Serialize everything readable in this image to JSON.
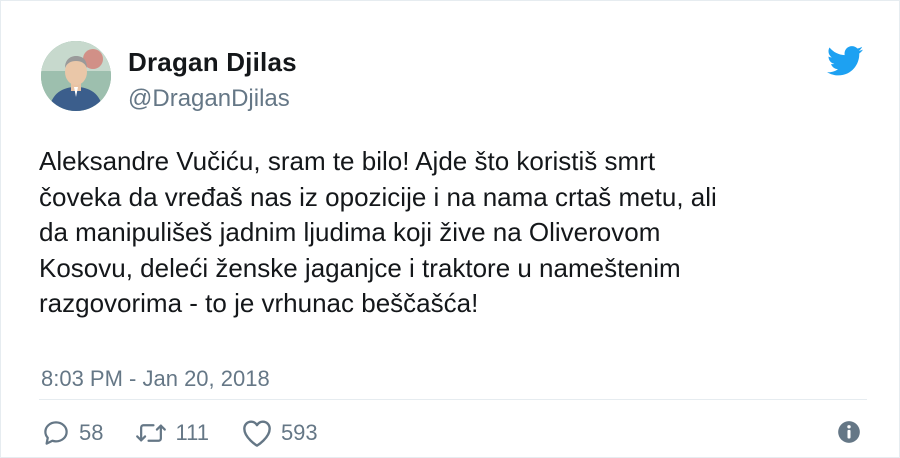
{
  "author": {
    "name": "Dragan Djilas",
    "handle": "@DraganDjilas",
    "avatar_icon": "profile-photo"
  },
  "tweet": {
    "text": "Aleksandre Vučiću, sram te bilo! Ajde što koristiš smrt\nčoveka da vređaš nas iz opozicije i na nama crtaš metu, ali\nda manipulišeš jadnim ljudima koji žive na Oliverovom\nKosovu, deleći ženske jaganjce i traktore u nameštenim\nrazgovorima - to je vrhunac beščašća!",
    "timestamp": "8:03 PM - Jan 20, 2018"
  },
  "actions": {
    "replies": {
      "icon": "reply-icon",
      "count": "58"
    },
    "retweets": {
      "icon": "retweet-icon",
      "count": "111"
    },
    "likes": {
      "icon": "heart-icon",
      "count": "593"
    },
    "info_icon": "info-icon"
  },
  "colors": {
    "brand": "#1da1f2",
    "text": "#14171a",
    "secondary": "#657786",
    "divider": "#e6ecf0"
  }
}
